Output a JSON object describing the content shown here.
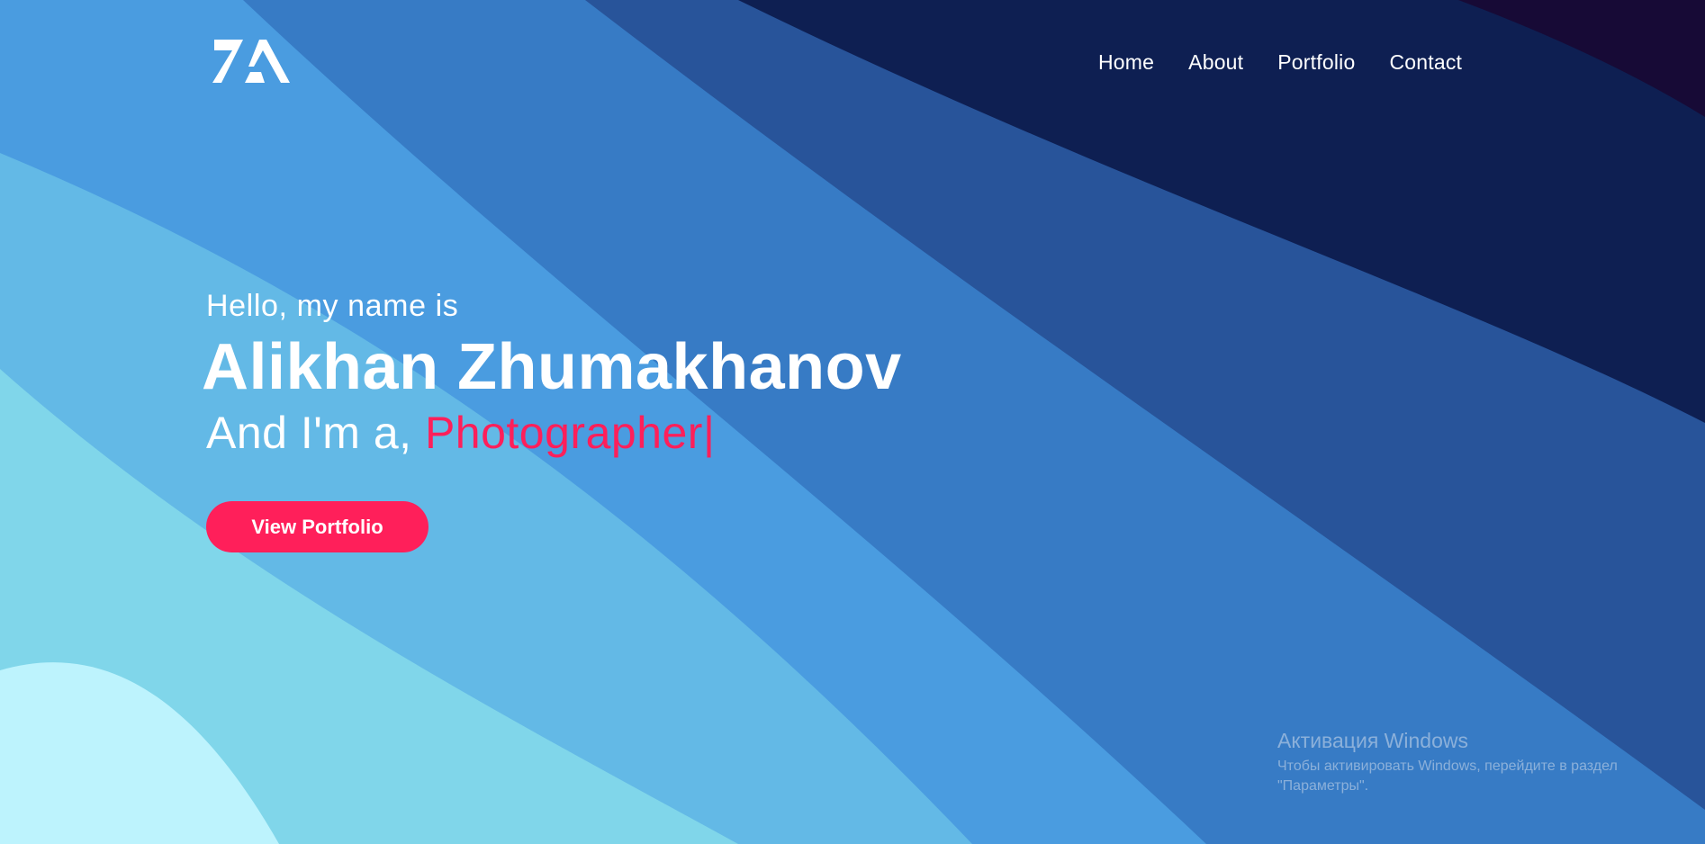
{
  "logo": {
    "icon": "za-monogram-logo",
    "color": "#ffffff"
  },
  "nav": {
    "items": [
      {
        "label": "Home"
      },
      {
        "label": "About"
      },
      {
        "label": "Portfolio"
      },
      {
        "label": "Contact"
      }
    ]
  },
  "hero": {
    "greeting": "Hello, my name is",
    "name": "Alikhan Zhumakhanov",
    "role_prefix": "And I'm a,",
    "role_word": "Photographer",
    "cursor": "|",
    "cta_label": "View Portfolio"
  },
  "watermark": {
    "title": "Активация Windows",
    "line1": "Чтобы активировать Windows, перейдите в раздел",
    "line2": "\"Параметры\"."
  },
  "colors": {
    "accent": "#ff1f5a",
    "bg_bands": [
      "#0e1f52",
      "#28549a",
      "#377bc5",
      "#4a9ce0",
      "#63b9e6",
      "#80d6ea",
      "#bdf3fd"
    ]
  }
}
